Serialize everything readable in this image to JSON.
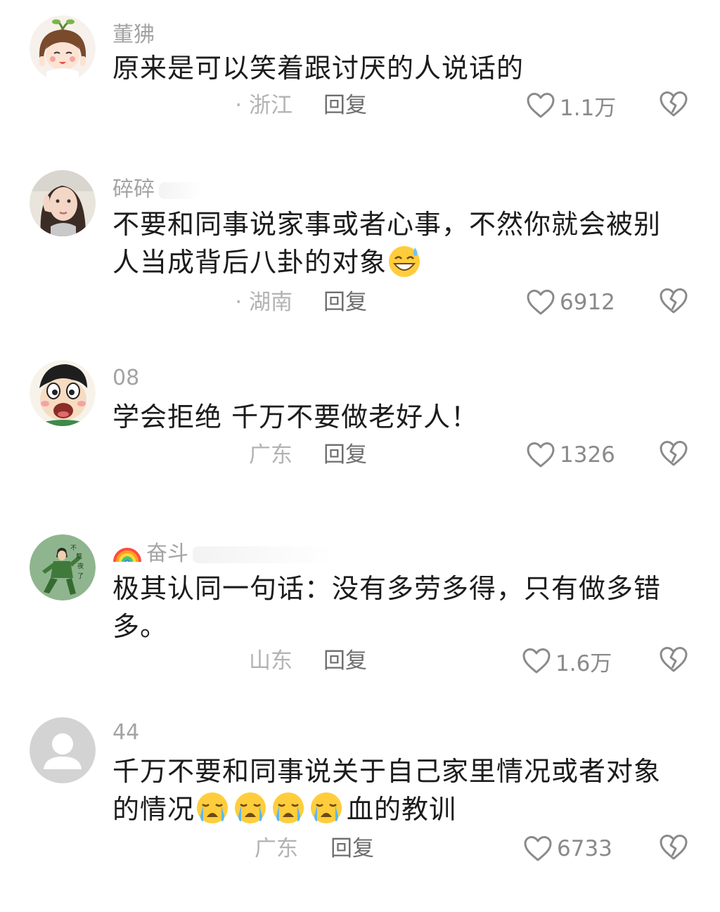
{
  "comments": [
    {
      "username": "董狒",
      "text": "原来是可以笑着跟讨厌的人说话的",
      "location": "· 浙江",
      "reply_label": "回复",
      "like_count": "1.1万"
    },
    {
      "username": "碎碎",
      "text": "不要和同事说家事或者心事，不然你就会被别人当成背后八卦的对象",
      "location": "· 湖南",
      "reply_label": "回复",
      "like_count": "6912"
    },
    {
      "username": "08",
      "text": "学会拒绝 千万不要做老好人！",
      "location": "广东",
      "reply_label": "回复",
      "like_count": "1326"
    },
    {
      "username": "奋斗",
      "text": "极其认同一句话：没有多劳多得，只有做多错多。",
      "location": "山东",
      "reply_label": "回复",
      "like_count": "1.6万"
    },
    {
      "username": "44",
      "text_before": "千万不要和同事说关于自己家里情况或者对象的情况",
      "text_after": "血的教训",
      "location": "广东",
      "reply_label": "回复",
      "like_count": "6733"
    }
  ],
  "icons": {
    "like": "heart-outline-icon",
    "dislike": "broken-heart-icon",
    "emoji_sweat": "grinning-sweat-emoji",
    "emoji_cry": "loudly-crying-emoji",
    "emoji_rainbow": "rainbow-emoji"
  },
  "colors": {
    "text": "#1c1c1c",
    "username": "#a3a3a3",
    "meta": "#b3b3b3",
    "reply": "#6e6e6e",
    "icon": "#8a8a8a"
  }
}
